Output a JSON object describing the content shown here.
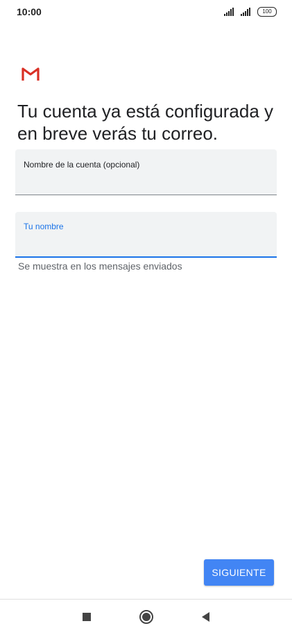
{
  "status_bar": {
    "time": "10:00",
    "battery": "100"
  },
  "logo": {
    "icon": "gmail-logo-icon",
    "color": "#d93025"
  },
  "headline": "Tu cuenta ya está configurada y en breve verás tu correo.",
  "account_name_field": {
    "label": "Nombre de la cuenta (opcional)",
    "value": ""
  },
  "your_name_field": {
    "label": "Tu nombre",
    "value": "",
    "helper": "Se muestra en los mensajes enviados",
    "accent_color": "#1a73e8"
  },
  "next_button": {
    "label": "SIGUIENTE",
    "color": "#4285f4"
  },
  "nav_bar": {
    "recent_icon": "square-icon",
    "home_icon": "circle-icon",
    "back_icon": "triangle-back-icon"
  }
}
